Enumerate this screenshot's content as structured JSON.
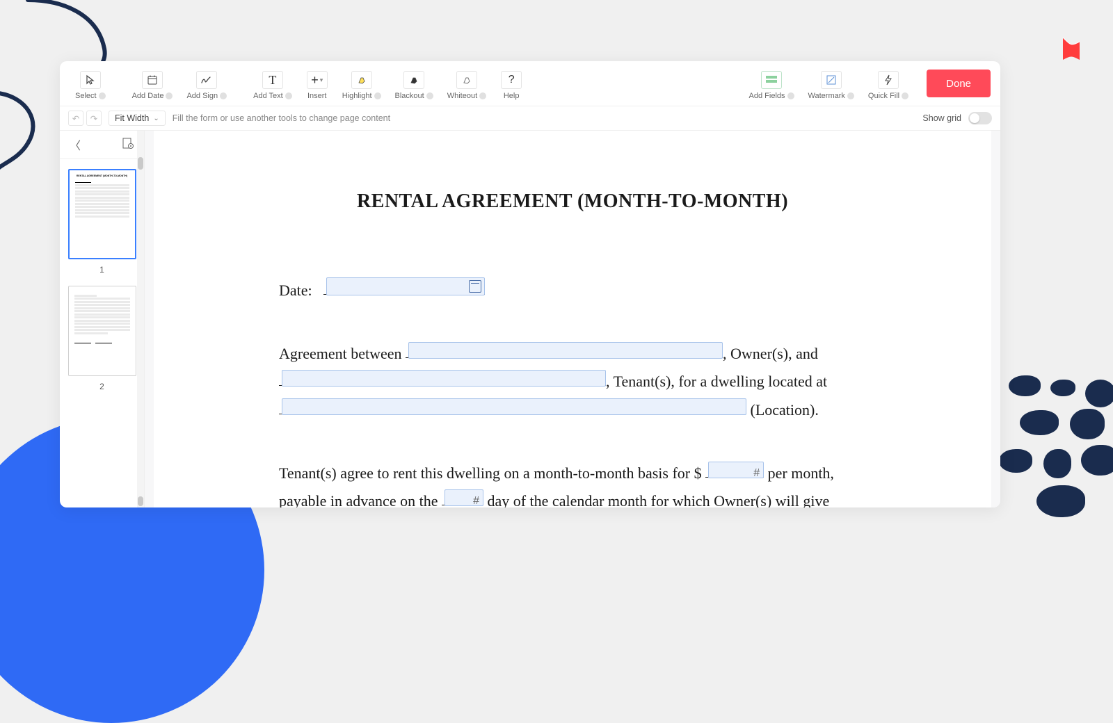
{
  "toolbar": {
    "select": "Select",
    "addDate": "Add Date",
    "addSign": "Add Sign",
    "addText": "Add Text",
    "insert": "Insert",
    "highlight": "Highlight",
    "blackout": "Blackout",
    "whiteout": "Whiteout",
    "help": "Help",
    "addFields": "Add Fields",
    "watermark": "Watermark",
    "quickFill": "Quick Fill",
    "done": "Done"
  },
  "subbar": {
    "zoom": "Fit Width",
    "hint": "Fill the form or use another tools to change page content",
    "showGrid": "Show grid"
  },
  "thumbs": {
    "p1": "1",
    "p2": "2"
  },
  "doc": {
    "title": "RENTAL AGREEMENT (MONTH-TO-MONTH)",
    "dateLabel": "Date:",
    "para1a": "Agreement between",
    "para1b": ", Owner(s), and",
    "para1c": ", Tenant(s), for a dwelling located at",
    "para1d": " (Location).",
    "para2a": "Tenant(s) agree to rent this dwelling on a month-to-month basis for $",
    "para2b": " per month, payable in advance on the ",
    "para2c": " day of the calendar month for which Owner(s) will give"
  }
}
